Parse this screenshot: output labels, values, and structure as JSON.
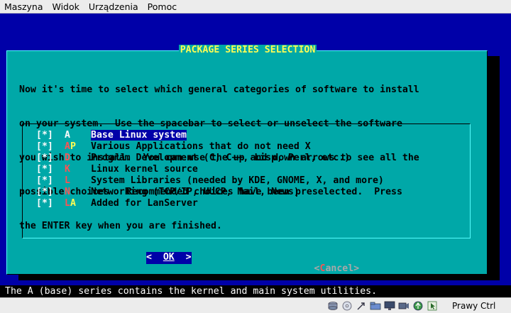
{
  "menubar": {
    "items": [
      {
        "label": "Maszyna",
        "accel": "M"
      },
      {
        "label": "Widok",
        "accel": "W"
      },
      {
        "label": "Urządzenia",
        "accel": "U"
      },
      {
        "label": "Pomoc",
        "accel": "P"
      }
    ]
  },
  "dialog": {
    "title": "PACKAGE SERIES SELECTION",
    "paragraph": [
      "Now it's time to select which general categories of software to install",
      "on your system.  Use the spacebar to select or unselect the software",
      "you wish to install.  You can use the up and down arrows to see all the",
      "possible choices.  Recommended choices have been preselected.  Press",
      "the ENTER key when you are finished."
    ],
    "items": [
      {
        "check": "[*]",
        "key": "A",
        "key2": "",
        "desc": "Base Linux system",
        "selected": true
      },
      {
        "check": "[*]",
        "key": "A",
        "key2": "P",
        "desc": "Various Applications that do not need X",
        "selected": false
      },
      {
        "check": "[*]",
        "key": "D",
        "key2": "",
        "desc": "Program Development (C, C++, Lisp, Perl, etc.)",
        "selected": false
      },
      {
        "check": "[*]",
        "key": "K",
        "key2": "",
        "desc": "Linux kernel source",
        "selected": false
      },
      {
        "check": "[*]",
        "key": "L",
        "key2": "",
        "desc": "System Libraries (needed by KDE, GNOME, X, and more)",
        "selected": false
      },
      {
        "check": "[*]",
        "key": "N",
        "key2": "",
        "desc": "Networking (TCP/IP, UUCP, Mail, News)",
        "selected": false
      },
      {
        "check": "[*]",
        "key": "L",
        "key2": "A",
        "desc": "Added for LanServer",
        "selected": false
      }
    ],
    "ok_button": {
      "left": "<",
      "label": "OK",
      "right": ">"
    },
    "cancel_button": {
      "left": "<",
      "hot": "C",
      "rest": "ancel",
      "right": ">"
    }
  },
  "status_line": "The A (base) series contains the kernel and main system utilities.",
  "vbox_status": {
    "icons": [
      "hard-disk-icon",
      "optical-drive-icon",
      "usb-icon",
      "shared-folder-icon",
      "display-icon",
      "video-capture-icon",
      "network-icon",
      "mouse-integration-icon"
    ],
    "host_key": "Prawy Ctrl"
  },
  "colors": {
    "screen_bg": "#0000a8",
    "dialog_bg": "#00a8a8",
    "title": "#fcfc54",
    "hotkey": "#fc5454"
  }
}
